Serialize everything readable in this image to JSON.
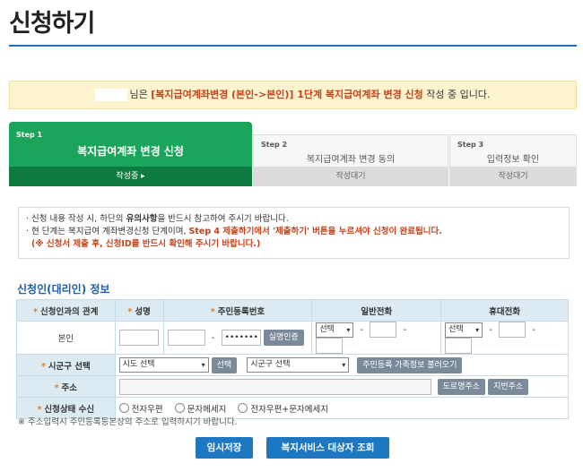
{
  "page": {
    "title": "신청하기"
  },
  "notice": {
    "suffix_name": "님은",
    "highlight": "[복지급여계좌변경 (본인->본인)] 1단계 복지급여계좌 변경 신청",
    "rest": "작성 중 입니다."
  },
  "steps": [
    {
      "no": "Step 1",
      "name": "복지급여계좌 변경 신청",
      "status": "작성중 ▸"
    },
    {
      "no": "Step 2",
      "name": "복지급여계좌 변경 동의",
      "status": "작성대기"
    },
    {
      "no": "Step 3",
      "name": "입력정보 확인",
      "status": "작성대기"
    }
  ],
  "info": {
    "line1_pre": "· 신청 내용 작성 시, 하단의",
    "line1_bold": "유의사항",
    "line1_post": "을 반드시 참고하여 주시기 바랍니다.",
    "line2_pre": "· 현 단계는 복지급여 계좌변경신청 단계이며,",
    "line2_hl": "Step 4 제출하기에서 '제출하기' 버튼을 누르셔야 신청이 완료됩니다.",
    "line3": "(※ 신청서 제출 후, 신청ID를 반드시 확인해 주시기 바랍니다.)"
  },
  "section": {
    "title": "신청인(대리인) 정보"
  },
  "form": {
    "headers": {
      "relation": "신청인과의 관계",
      "name": "성명",
      "rrn": "주민등록번호",
      "phone": "일반전화",
      "mobile": "휴대전화"
    },
    "row": {
      "relation_value": "본인",
      "rrn_masked": "•••••••",
      "verify_button": "실명인증",
      "phone_select": "선택",
      "mobile_select": "선택"
    },
    "region": {
      "label": "시군구 선택",
      "sido_select": "시도 선택",
      "select_button": "선택",
      "sigungu_select": "시군구 선택",
      "load_button": "주민등록 가족정보 불러오기"
    },
    "address": {
      "label": "주소",
      "road_button": "도로명주소",
      "lot_button": "지번주소"
    },
    "receive": {
      "label": "신청상태 수신",
      "options": [
        "전자우편",
        "문자메세지",
        "전자우편+문자메세지"
      ]
    }
  },
  "footnote": "※ 주소입력시 주민등록등본상의 주소로 입력하시기 바랍니다.",
  "buttons": {
    "save": "임시저장",
    "lookup": "복지서비스 대상자 조회"
  },
  "colors": {
    "step_active": "#1aa55a",
    "step_active_dark": "#0e7c40",
    "accent_blue": "#1d78c1",
    "highlight_red": "#c6421a"
  }
}
